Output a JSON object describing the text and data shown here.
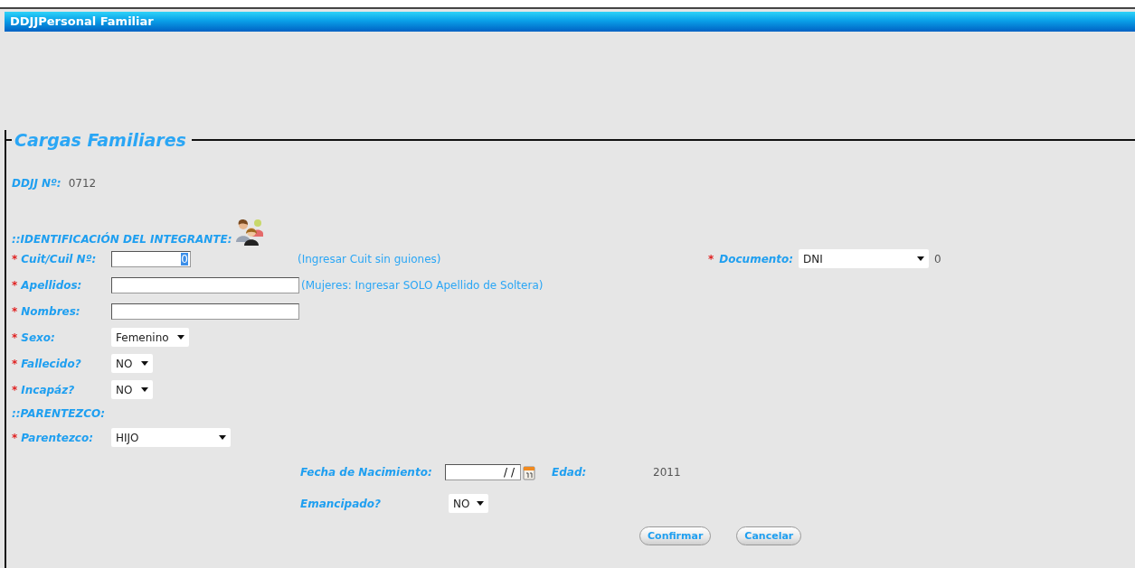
{
  "window": {
    "title": "DDJJPersonal Familiar"
  },
  "section": {
    "legend": "Cargas Familiares",
    "ddjj": {
      "label": "DDJJ Nº:",
      "value": "0712"
    },
    "identification_heading": "::IDENTIFICACIÓN DEL INTEGRANTE:",
    "document": {
      "label": "Documento:",
      "required_mark": "*",
      "value": "DNI",
      "extra": "0"
    },
    "fields": [
      {
        "kind": "text",
        "label": "Cuit/Cuil Nº:",
        "required_mark": "*",
        "value": "0",
        "highlighted": true,
        "hint": "(Ingresar Cuit sin guiones)"
      },
      {
        "kind": "text",
        "label": "Apellidos:",
        "required_mark": "*",
        "hint": "(Mujeres: Ingresar SOLO Apellido de Soltera)"
      },
      {
        "kind": "text",
        "label": "Nombres:",
        "required_mark": "*"
      },
      {
        "kind": "select",
        "label": "Sexo:",
        "required_mark": "*",
        "value": "Femenino"
      },
      {
        "kind": "select",
        "label": "Fallecido?",
        "required_mark": "*",
        "value": "NO"
      },
      {
        "kind": "select",
        "label": "Incapáz?",
        "required_mark": "*",
        "value": "NO"
      },
      {
        "kind": "heading",
        "label": "::PARENTEZCO:"
      },
      {
        "kind": "select",
        "label": "Parentezco:",
        "required_mark": "*",
        "value": "HIJO"
      }
    ],
    "birth": {
      "label": "Fecha de Nacimiento:",
      "value": "/ /"
    },
    "age": {
      "label": "Edad:",
      "value": "2011"
    },
    "emancipated": {
      "label": "Emancipado?",
      "value": "NO"
    },
    "buttons": [
      "Confirmar",
      "Cancelar"
    ]
  }
}
